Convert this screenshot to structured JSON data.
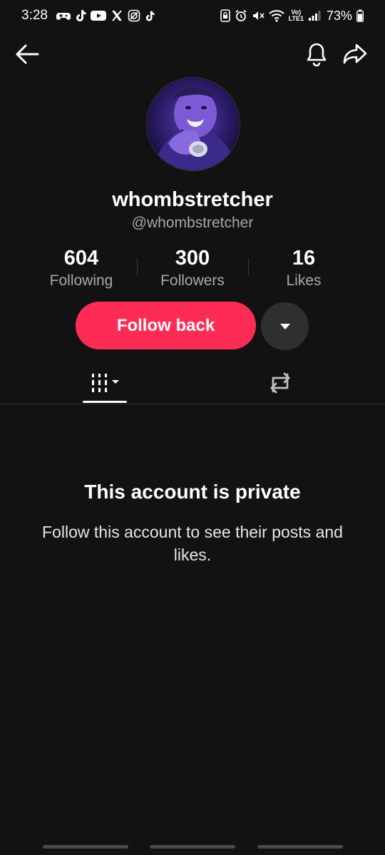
{
  "status_bar": {
    "time": "3:28",
    "battery": "73%",
    "network_label": "LTE1",
    "volte_label": "Vo)"
  },
  "profile": {
    "display_name": "whombstretcher",
    "handle": "@whombstretcher",
    "stats": [
      {
        "value": "604",
        "label": "Following"
      },
      {
        "value": "300",
        "label": "Followers"
      },
      {
        "value": "16",
        "label": "Likes"
      }
    ]
  },
  "actions": {
    "follow_back_label": "Follow back"
  },
  "tabs": [
    {
      "name": "videos",
      "icon": "grid-filter-icon",
      "selected": true
    },
    {
      "name": "reposts",
      "icon": "repost-icon",
      "selected": false
    }
  ],
  "private_notice": {
    "title": "This account is private",
    "description": "Follow this account to see their posts and likes."
  },
  "colors": {
    "background": "#121212",
    "accent": "#fe2c55",
    "secondary_text": "#a7a7a7"
  }
}
